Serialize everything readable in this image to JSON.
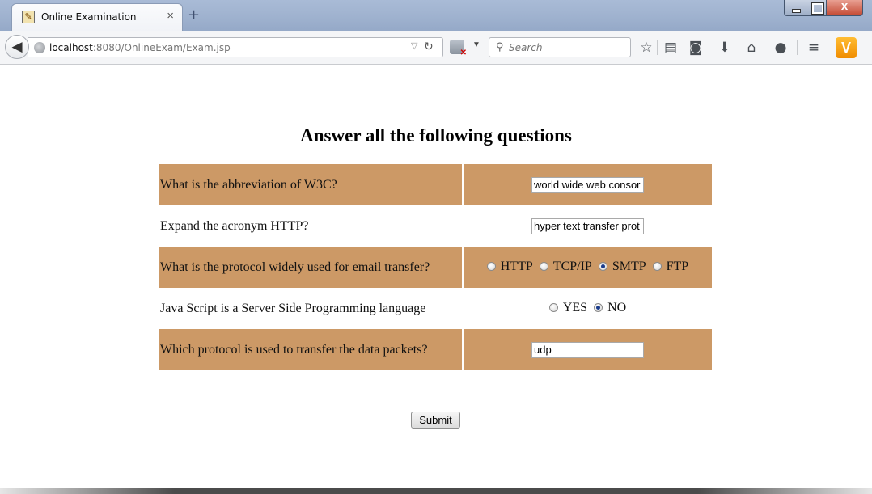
{
  "browser": {
    "tab_title": "Online Examination",
    "tab_close": "×",
    "new_tab": "+",
    "url_host": "localhost",
    "url_path": ":8080/OnlineExam/Exam.jsp",
    "search_placeholder": "Search",
    "close_glyph": "x"
  },
  "page": {
    "heading": "Answer all the following questions",
    "submit_label": "Submit"
  },
  "questions": [
    {
      "text": "What is the abbreviation of W3C?",
      "type": "text",
      "value": "world wide web consor"
    },
    {
      "text": "Expand the acronym HTTP?",
      "type": "text",
      "value": "hyper text transfer prot"
    },
    {
      "text": "What is the protocol widely used for email transfer?",
      "type": "radio",
      "options": [
        "HTTP",
        "TCP/IP",
        "SMTP",
        "FTP"
      ],
      "selected": "SMTP"
    },
    {
      "text": "Java Script is a Server Side Programming language",
      "type": "radio",
      "options": [
        "YES",
        "NO"
      ],
      "selected": "NO"
    },
    {
      "text": "Which protocol is used to transfer the data packets?",
      "type": "text",
      "value": "udp"
    }
  ],
  "colors": {
    "row_shade": "#cc9966",
    "title_bar": "#9fb2cf"
  },
  "icons": {
    "tab": "exam-favicon-icon",
    "back": "back-arrow-icon",
    "bookmark": "star-icon",
    "reading_list": "clipboard-icon",
    "pocket": "pocket-icon",
    "downloads": "download-arrow-icon",
    "home": "home-icon",
    "chat": "chat-bubble-icon",
    "menu": "hamburger-menu-icon",
    "extension": "vivaldi-v-icon"
  }
}
